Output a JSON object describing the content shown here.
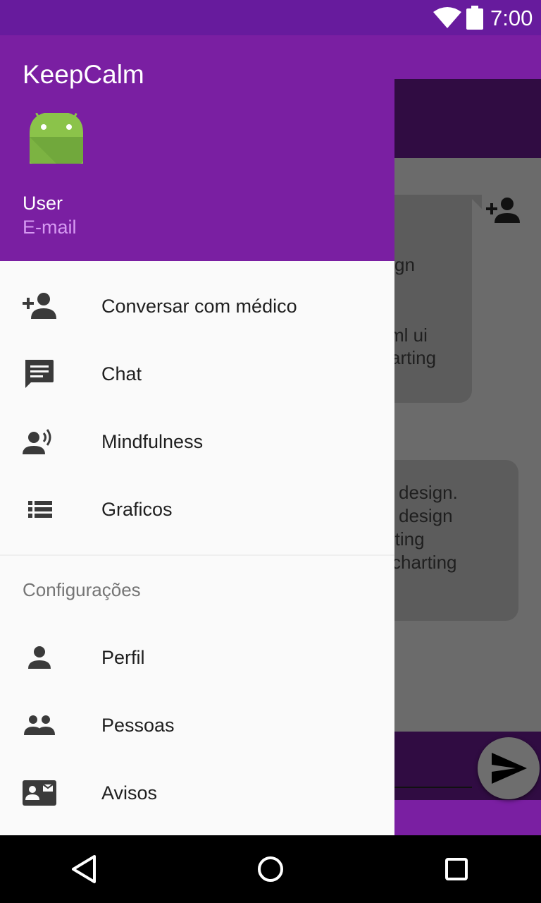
{
  "status_bar": {
    "time": "7:00"
  },
  "drawer": {
    "app_title": "KeepCalm",
    "user_name": "User",
    "user_email": "E-mail",
    "items": [
      {
        "label": "Conversar com médico",
        "icon": "add-person-icon"
      },
      {
        "label": "Chat",
        "icon": "chat-icon"
      },
      {
        "label": "Mindfulness",
        "icon": "record-voice-icon"
      },
      {
        "label": "Graficos",
        "icon": "list-icon"
      }
    ],
    "section_title": "Configurações",
    "settings_items": [
      {
        "label": "Perfil",
        "icon": "person-icon"
      },
      {
        "label": "Pessoas",
        "icon": "people-icon"
      },
      {
        "label": "Avisos",
        "icon": "contact-mail-icon"
      }
    ]
  },
  "background": {
    "bubble1_lines": [
      "gn",
      "ml ui",
      "arting"
    ],
    "bubble2_lines": [
      "design.",
      "design",
      "rting",
      "charting"
    ]
  },
  "colors": {
    "primary": "#7a1fa2",
    "status_bar": "#671b9d",
    "dark_toolbar": "#300c42",
    "drawer_bg": "#fafafa",
    "email_text": "#d69af2"
  }
}
